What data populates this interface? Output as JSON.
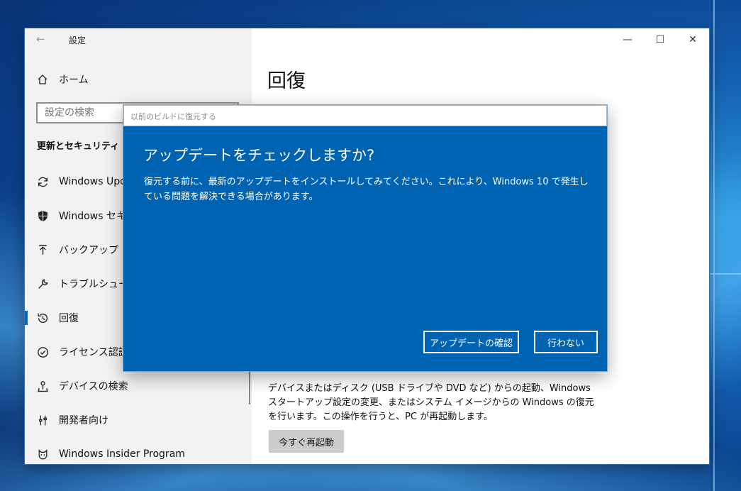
{
  "window": {
    "title": "設定",
    "minimize": "—",
    "maximize": "☐",
    "close": "✕"
  },
  "sidebar": {
    "home_label": "ホーム",
    "search_placeholder": "設定の検索",
    "section_header": "更新とセキュリティ",
    "items": [
      {
        "label": "Windows Update",
        "icon": "refresh-icon"
      },
      {
        "label": "Windows セキュリティ",
        "icon": "shield-icon"
      },
      {
        "label": "バックアップ",
        "icon": "upload-icon"
      },
      {
        "label": "トラブルシューティング",
        "icon": "wrench-icon"
      },
      {
        "label": "回復",
        "icon": "recovery-icon",
        "active": true
      },
      {
        "label": "ライセンス認証",
        "icon": "check-circle-icon"
      },
      {
        "label": "デバイスの検索",
        "icon": "person-pin-icon"
      },
      {
        "label": "開発者向け",
        "icon": "developer-icon"
      },
      {
        "label": "Windows Insider Program",
        "icon": "cat-icon"
      }
    ]
  },
  "content": {
    "page_title": "回復",
    "advanced_desc": "デバイスまたはディスク (USB ドライブや DVD など) からの起動、Windows スタートアップ設定の変更、またはシステム イメージからの Windows の復元を行います。この操作を行うと、PC が再起動します。",
    "restart_button": "今すぐ再起動"
  },
  "dialog": {
    "title": "以前のビルドに復元する",
    "heading": "アップデートをチェックしますか?",
    "body": "復元する前に、最新のアップデートをインストールしてみてください。これにより、Windows 10 で発生している問題を解決できる場合があります。",
    "check_button": "アップデートの確認",
    "no_button": "行わない"
  },
  "colors": {
    "dialog_bg": "#0063b1",
    "accent": "#0a64b4",
    "sidebar_bg": "#f2f2f2"
  }
}
